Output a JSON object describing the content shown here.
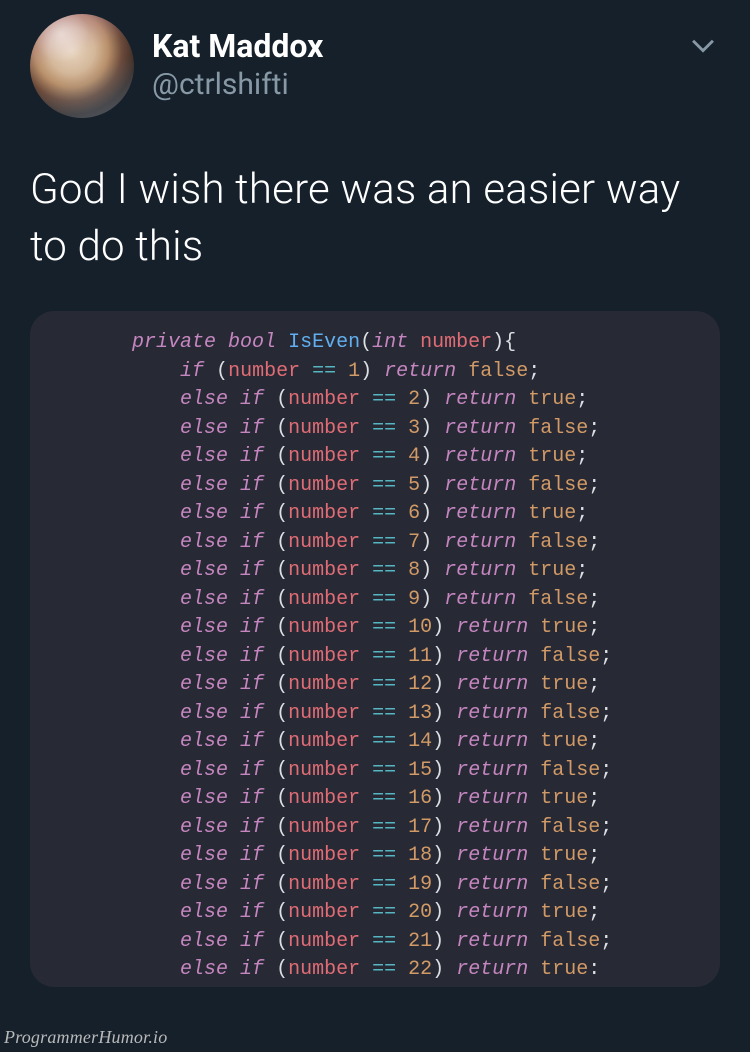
{
  "user": {
    "display_name": "Kat Maddox",
    "handle": "@ctrlshifti"
  },
  "tweet_text": "God I wish there was an easier way to do this",
  "watermark": "ProgrammerHumor.io",
  "code": {
    "signature": {
      "keyword_private": "private",
      "keyword_bool": "bool",
      "function_name": "IsEven",
      "keyword_int": "int",
      "param_name": "number"
    },
    "keyword_if": "if",
    "keyword_else": "else",
    "keyword_return": "return",
    "branches": [
      {
        "n": "1",
        "ret": "false"
      },
      {
        "n": "2",
        "ret": "true"
      },
      {
        "n": "3",
        "ret": "false"
      },
      {
        "n": "4",
        "ret": "true"
      },
      {
        "n": "5",
        "ret": "false"
      },
      {
        "n": "6",
        "ret": "true"
      },
      {
        "n": "7",
        "ret": "false"
      },
      {
        "n": "8",
        "ret": "true"
      },
      {
        "n": "9",
        "ret": "false"
      },
      {
        "n": "10",
        "ret": "true"
      },
      {
        "n": "11",
        "ret": "false"
      },
      {
        "n": "12",
        "ret": "true"
      },
      {
        "n": "13",
        "ret": "false"
      },
      {
        "n": "14",
        "ret": "true"
      },
      {
        "n": "15",
        "ret": "false"
      },
      {
        "n": "16",
        "ret": "true"
      },
      {
        "n": "17",
        "ret": "false"
      },
      {
        "n": "18",
        "ret": "true"
      },
      {
        "n": "19",
        "ret": "false"
      },
      {
        "n": "20",
        "ret": "true"
      },
      {
        "n": "21",
        "ret": "false"
      },
      {
        "n": "22",
        "ret": "true"
      }
    ]
  }
}
